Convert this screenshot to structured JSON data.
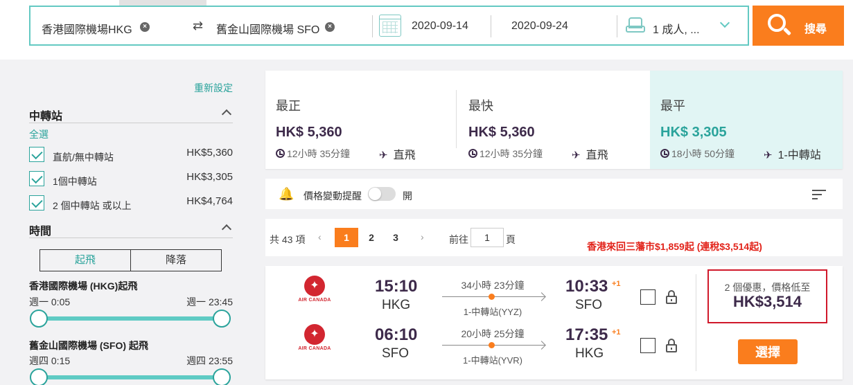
{
  "search": {
    "origin": "香港國際機場HKG",
    "destination": "舊金山國際機場 SFO",
    "depart_date": "2020-09-14",
    "return_date": "2020-09-24",
    "passengers": "1 成人, ...",
    "search_label": "搜尋",
    "clear_glyph": "×",
    "swap_glyph": "⇄"
  },
  "sidebar": {
    "reset_label": "重新設定",
    "stops_title": "中轉站",
    "select_all": "全選",
    "stops": [
      {
        "label": "直航/無中轉站",
        "price": "HK$5,360"
      },
      {
        "label": "1個中轉站",
        "price": "HK$3,305"
      },
      {
        "label": "2 個中轉站 或以上",
        "price": "HK$4,764"
      }
    ],
    "time_title": "時間",
    "seg_depart": "起飛",
    "seg_arrive": "降落",
    "sliders": [
      {
        "title": "香港國際機場 (HKG)起飛",
        "from": "週一 0:05",
        "to": "週一 23:45",
        "lo": 0.0,
        "hi": 1.0
      },
      {
        "title": "舊金山國際機場 (SFO) 起飛",
        "from": "週四 0:15",
        "to": "週四 23:55",
        "lo": 0.0,
        "hi": 1.0
      }
    ]
  },
  "summary": [
    {
      "title": "最正",
      "price": "HK$ 5,360",
      "duration": "12小時 35分鐘",
      "stops": "直飛"
    },
    {
      "title": "最快",
      "price": "HK$ 5,360",
      "duration": "12小時 35分鐘",
      "stops": "直飛"
    },
    {
      "title": "最平",
      "price": "HK$ 3,305",
      "duration": "18小時 50分鐘",
      "stops": "1-中轉站"
    }
  ],
  "alert": {
    "label": "價格變動提醒",
    "toggle_label": "開"
  },
  "pager": {
    "total": "共 43 項",
    "prev": "‹",
    "next": "›",
    "pages": [
      "1",
      "2",
      "3"
    ],
    "goto_label": "前往",
    "goto_value": "1",
    "page_label": "頁",
    "promo": "香港來回三藩市$1,859起 (連稅$3,514起)"
  },
  "flight": {
    "airline": "AIR CANADA",
    "legs": [
      {
        "dep_time": "15:10",
        "dep_code": "HKG",
        "duration": "34小時 23分鐘",
        "stops": "1-中轉站(YYZ)",
        "arr_time": "10:33",
        "arr_code": "SFO",
        "plus": "+1"
      },
      {
        "dep_time": "06:10",
        "dep_code": "SFO",
        "duration": "20小時 25分鐘",
        "stops": "1-中轉站(YVR)",
        "arr_time": "17:35",
        "arr_code": "HKG",
        "plus": "+1"
      }
    ],
    "deal_text": "2 個優惠，價格低至",
    "deal_price": "HK$3,514",
    "select_label": "選擇"
  },
  "colors": {
    "accent_teal": "#2aa39b",
    "accent_orange": "#fa7d1d",
    "deal_red": "#d0182a",
    "brand_dark": "#3d2a4a"
  }
}
